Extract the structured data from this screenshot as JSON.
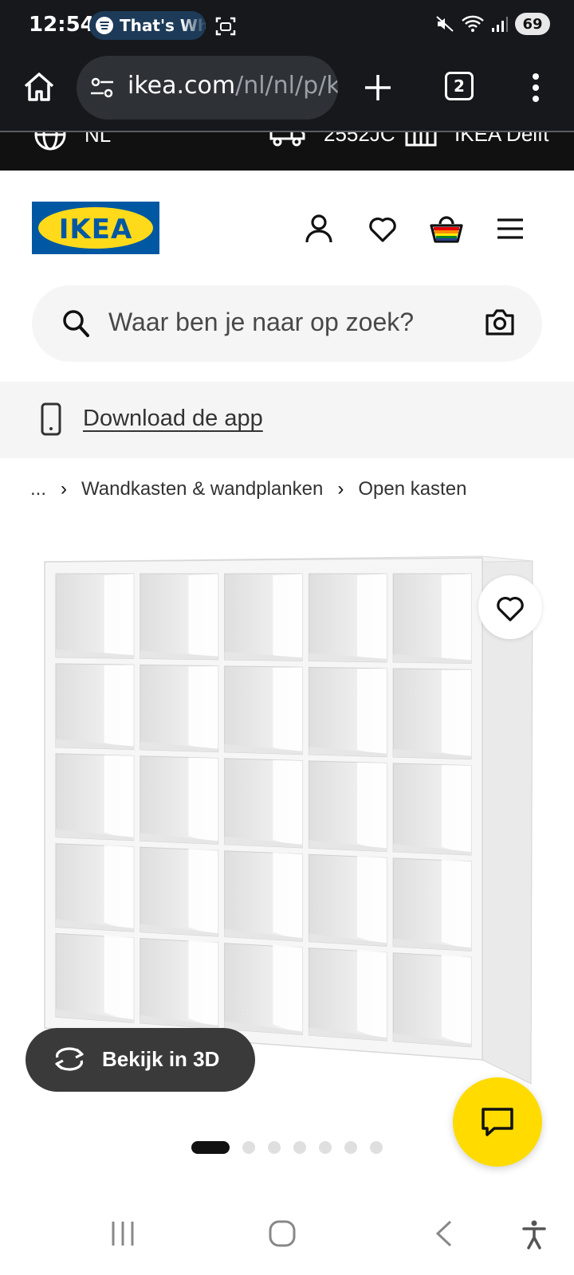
{
  "status_bar": {
    "time": "12:54",
    "media_pill_text": "That's Wh",
    "battery": "69"
  },
  "browser": {
    "url_host": "ikea.com",
    "url_path": "/nl/nl/p/k",
    "tab_count": "2"
  },
  "top_strip": {
    "language": "NL",
    "postcode": "2552JC",
    "store": "IKEA Delft"
  },
  "header": {
    "logo_text": "IKEA"
  },
  "search": {
    "placeholder": "Waar ben je naar op zoek?"
  },
  "app_banner": {
    "link_label": "Download de app"
  },
  "breadcrumb": {
    "items": [
      "...",
      "Wandkasten & wandplanken",
      "Open kasten"
    ]
  },
  "gallery": {
    "view_3d_label": "Bekijk in 3D",
    "image_count": 7,
    "active_index": 0
  },
  "icons": {
    "home": "home-icon",
    "site_settings": "tune-icon",
    "profile": "profile-icon",
    "favorite": "heart-icon",
    "cart": "shopping-bag-icon",
    "menu": "hamburger-icon",
    "search": "search-icon",
    "camera": "camera-icon",
    "phone": "phone-icon",
    "chat": "chat-icon",
    "rotate": "rotate-3d-icon"
  },
  "colors": {
    "ikea_blue": "#0058a3",
    "ikea_yellow": "#ffda1a",
    "chat_yellow": "#ffdb00"
  }
}
